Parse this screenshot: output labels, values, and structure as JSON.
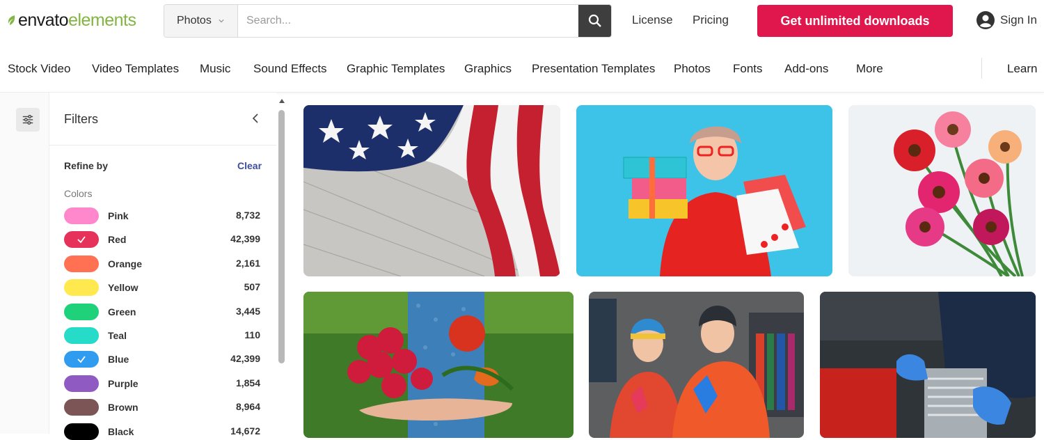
{
  "header": {
    "logo_part1": "envato",
    "logo_part2": "elements",
    "search": {
      "category": "Photos",
      "placeholder": "Search..."
    },
    "links": [
      "License",
      "Pricing"
    ],
    "cta_label": "Get unlimited downloads",
    "signin_label": "Sign In",
    "brand_color": "#e0174d",
    "logo_accent": "#82b541"
  },
  "catnav": {
    "items": [
      "Stock Video",
      "Video Templates",
      "Music",
      "Sound Effects",
      "Graphic Templates",
      "Graphics",
      "Presentation Templates",
      "Photos",
      "Fonts",
      "Add-ons",
      "More"
    ],
    "learn": "Learn"
  },
  "filters": {
    "title": "Filters",
    "refine_label": "Refine by",
    "clear_label": "Clear",
    "colors_label": "Colors",
    "colors": [
      {
        "name": "Pink",
        "count": "8,732",
        "hex": "#ff88cc",
        "checked": false
      },
      {
        "name": "Red",
        "count": "42,399",
        "hex": "#e6325a",
        "checked": true
      },
      {
        "name": "Orange",
        "count": "2,161",
        "hex": "#ff7152",
        "checked": false
      },
      {
        "name": "Yellow",
        "count": "507",
        "hex": "#ffe94f",
        "checked": false
      },
      {
        "name": "Green",
        "count": "3,445",
        "hex": "#1fd17a",
        "checked": false
      },
      {
        "name": "Teal",
        "count": "110",
        "hex": "#26dbc7",
        "checked": false
      },
      {
        "name": "Blue",
        "count": "42,399",
        "hex": "#2f9cf0",
        "checked": true
      },
      {
        "name": "Purple",
        "count": "1,854",
        "hex": "#8f5bc2",
        "checked": false
      },
      {
        "name": "Brown",
        "count": "8,964",
        "hex": "#7c5656",
        "checked": false
      },
      {
        "name": "Black",
        "count": "14,672",
        "hex": "#000000",
        "checked": false
      }
    ]
  },
  "photos": [
    {
      "subject": "american-flag-on-wood"
    },
    {
      "subject": "woman-with-gifts"
    },
    {
      "subject": "gerbera-flowers"
    },
    {
      "subject": "radish-and-tomato-in-hand"
    },
    {
      "subject": "couple-in-winter-wear"
    },
    {
      "subject": "mechanic-gloves-engine"
    }
  ]
}
